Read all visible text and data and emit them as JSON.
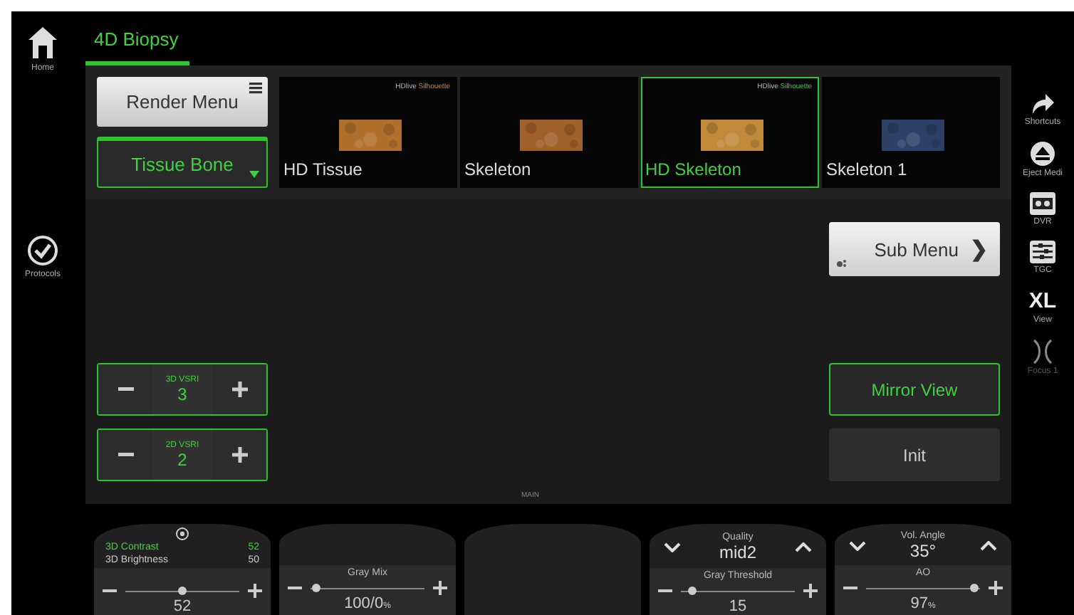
{
  "left_nav": [
    {
      "kind": "home",
      "label": "Home"
    },
    {
      "kind": "check",
      "label": "Protocols"
    }
  ],
  "tab": {
    "label": "4D Biopsy",
    "selected": true
  },
  "render_menu": {
    "label": "Render Menu"
  },
  "render_mode": {
    "label": "Tissue Bone"
  },
  "presets": [
    {
      "label": "HD Tissue",
      "tag_1": "HDlive",
      "tag_2": "Silhouette",
      "selected": false,
      "color": "#b0702c"
    },
    {
      "label": "Skeleton",
      "selected": false,
      "color": "#a0602a"
    },
    {
      "label": "HD Skeleton",
      "tag_1": "HDlive",
      "tag_2": "Silhouette",
      "selected": true,
      "color": "#c08a3a"
    },
    {
      "label": "Skeleton 1",
      "selected": false,
      "color": "#2c4068"
    }
  ],
  "sub_menu": {
    "label": "Sub Menu",
    "arrow": "❯"
  },
  "steppers": [
    {
      "label": "3D VSRI",
      "value": "3"
    },
    {
      "label": "2D VSRI",
      "value": "2"
    }
  ],
  "mirror_view": {
    "label": "Mirror View",
    "on": true
  },
  "init": {
    "label": "Init"
  },
  "main_label": "MAIN",
  "right_nav": [
    {
      "kind": "shortcut",
      "label": "Shortcuts"
    },
    {
      "kind": "eject",
      "label": "Eject Medi"
    },
    {
      "kind": "dvr",
      "label": "DVR"
    },
    {
      "kind": "tgc",
      "label": "TGC"
    },
    {
      "kind": "xl",
      "text": "XL",
      "label": "View"
    },
    {
      "kind": "focus",
      "label": "Focus 1"
    }
  ],
  "knobs": [
    {
      "kind": "params",
      "params": [
        {
          "name": "3D Contrast",
          "value": "52",
          "selected": true
        },
        {
          "name": "3D Brightness",
          "value": "50",
          "selected": false
        }
      ],
      "slider": {
        "value": "52",
        "level": 0.5
      }
    },
    {
      "kind": "slider",
      "slider": {
        "label": "Gray Mix",
        "value": "100/0",
        "unit": "%",
        "level": 0.05
      }
    },
    {
      "kind": "empty"
    },
    {
      "kind": "select",
      "select": {
        "label": "Quality",
        "value": "mid2"
      },
      "slider": {
        "label": "Gray Threshold",
        "value": "15",
        "level": 0.1
      }
    },
    {
      "kind": "select",
      "select": {
        "label": "Vol. Angle",
        "value": "35°"
      },
      "slider": {
        "label": "AO",
        "value": "97",
        "unit": "%",
        "level": 0.95
      }
    }
  ]
}
